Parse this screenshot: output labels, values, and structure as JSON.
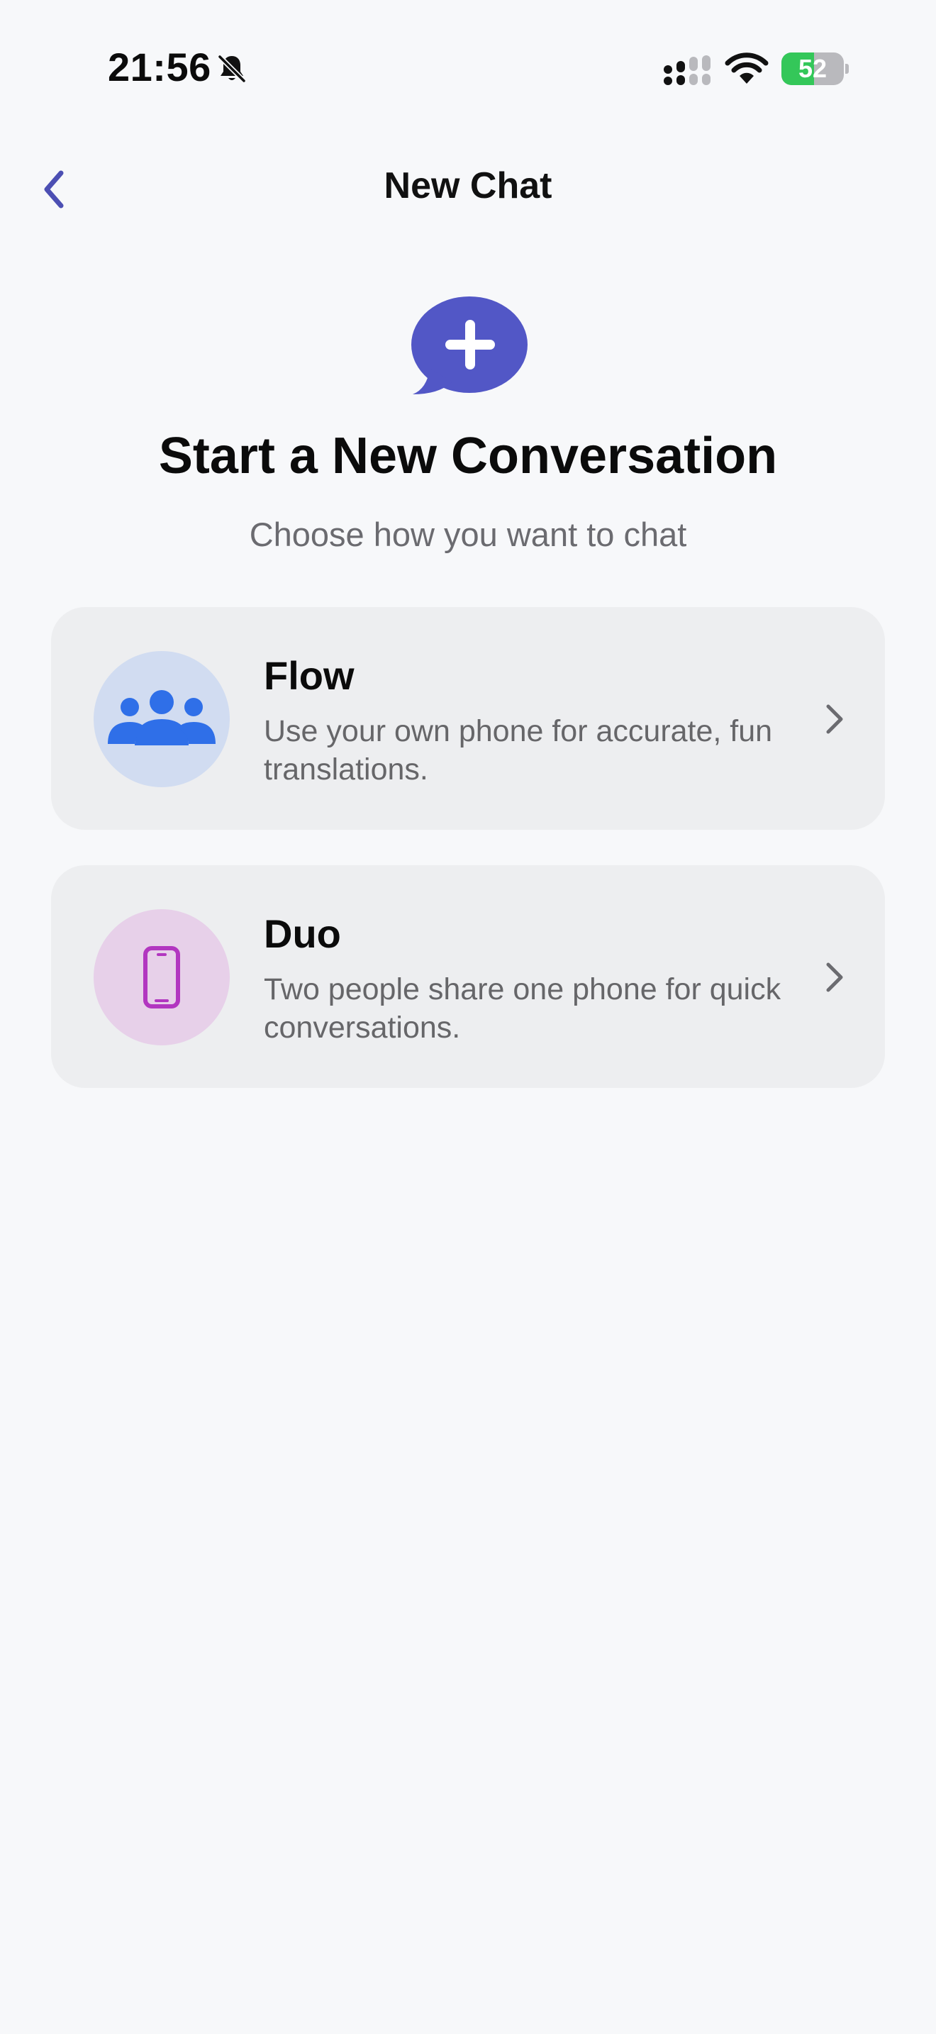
{
  "status_bar": {
    "time": "21:56",
    "battery_level": "52",
    "battery_fraction": 0.52,
    "icons": [
      "bell-slash-icon",
      "cellular-signal-icon",
      "wifi-icon",
      "battery-charging-icon"
    ]
  },
  "nav": {
    "title": "New Chat",
    "back_icon": "chevron-left-icon"
  },
  "hero": {
    "icon": "chat-bubble-plus-icon",
    "title": "Start a New Conversation",
    "subtitle": "Choose how you want to chat"
  },
  "options": [
    {
      "title": "Flow",
      "description": "Use your own phone for accurate, fun translations.",
      "icon": "people-group-icon",
      "icon_color": "#2f6fe8",
      "avatar_bg": "#d1dcf1"
    },
    {
      "title": "Duo",
      "description": "Two people share one phone for quick conversations.",
      "icon": "smartphone-icon",
      "icon_color": "#b236c0",
      "avatar_bg": "#e7d0e9"
    }
  ],
  "colors": {
    "accent": "#5257c6",
    "background": "#f7f8fa",
    "card": "#edeef0",
    "battery_green": "#34c759"
  }
}
